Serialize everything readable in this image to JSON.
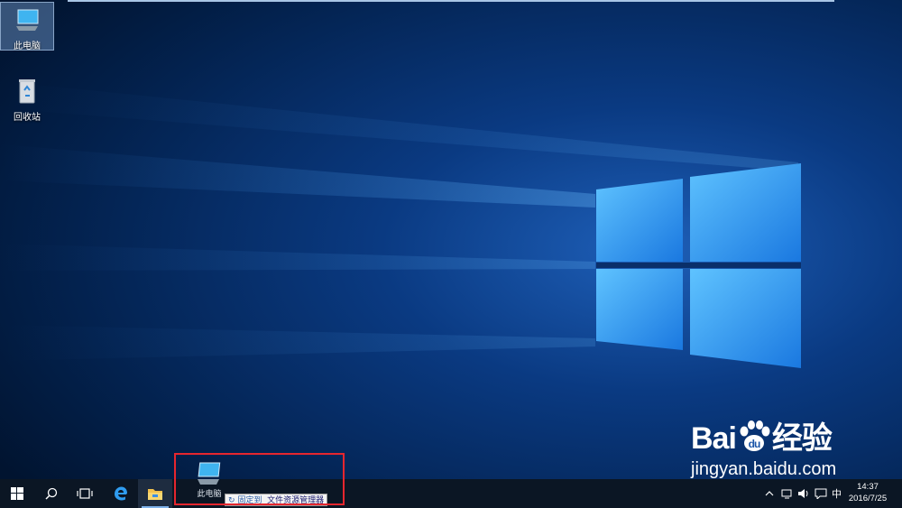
{
  "desktop": {
    "icons": [
      {
        "label": "此电脑",
        "icon": "computer-icon",
        "selected": true
      },
      {
        "label": "回收站",
        "icon": "recycle-bin-icon",
        "selected": false
      }
    ]
  },
  "drag": {
    "ghost_label": "此电脑",
    "tooltip_pin": "固定到",
    "tooltip_target": "文件资源管理器"
  },
  "taskbar": {
    "buttons": [
      "start-icon",
      "search-icon",
      "task-view-icon",
      "edge-icon",
      "file-explorer-icon"
    ],
    "accent": "#7fb2ea"
  },
  "tray": {
    "ime": "中",
    "time": "14:37",
    "date": "2016/7/25"
  },
  "watermark": {
    "brand_prefix": "Bai",
    "brand_suffix": "经验",
    "url": "jingyan.baidu.com"
  }
}
